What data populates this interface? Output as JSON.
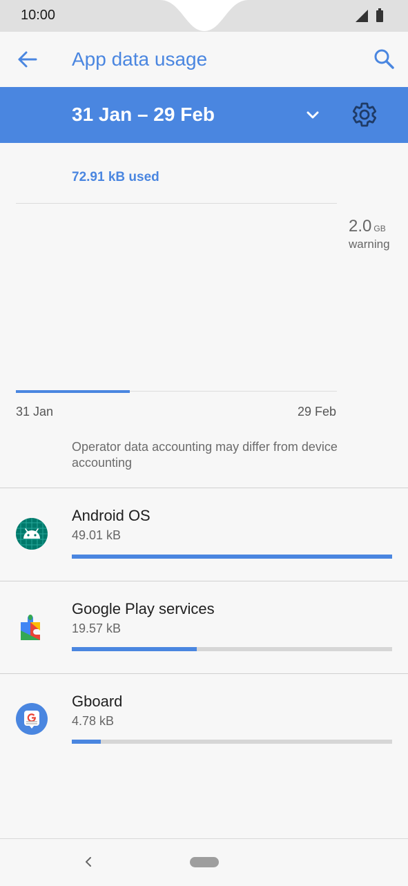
{
  "status_bar": {
    "time": "10:00"
  },
  "app_bar": {
    "title": "App data usage",
    "back_icon": "arrow-back-icon",
    "search_icon": "search-icon"
  },
  "cycle": {
    "label": "31 Jan – 29 Feb",
    "dropdown_icon": "chevron-down-icon",
    "settings_icon": "gear-icon"
  },
  "summary": {
    "used": "72.91 kB used",
    "usage_fraction": 0.355,
    "warning_value": "2.0",
    "warning_unit": "GB",
    "warning_label": "warning",
    "start_date": "31 Jan",
    "end_date": "29 Feb",
    "disclaimer": "Operator data accounting may differ from device accounting"
  },
  "apps": [
    {
      "name": "Android OS",
      "usage": "49.01 kB",
      "fraction": 1.0,
      "icon": "android-os-icon"
    },
    {
      "name": "Google Play services",
      "usage": "19.57 kB",
      "fraction": 0.39,
      "icon": "google-play-services-icon"
    },
    {
      "name": "Gboard",
      "usage": "4.78 kB",
      "fraction": 0.09,
      "icon": "gboard-icon"
    }
  ],
  "colors": {
    "accent": "#4a86e0",
    "status_bar": "#e0e0e0",
    "background": "#f7f7f7"
  }
}
